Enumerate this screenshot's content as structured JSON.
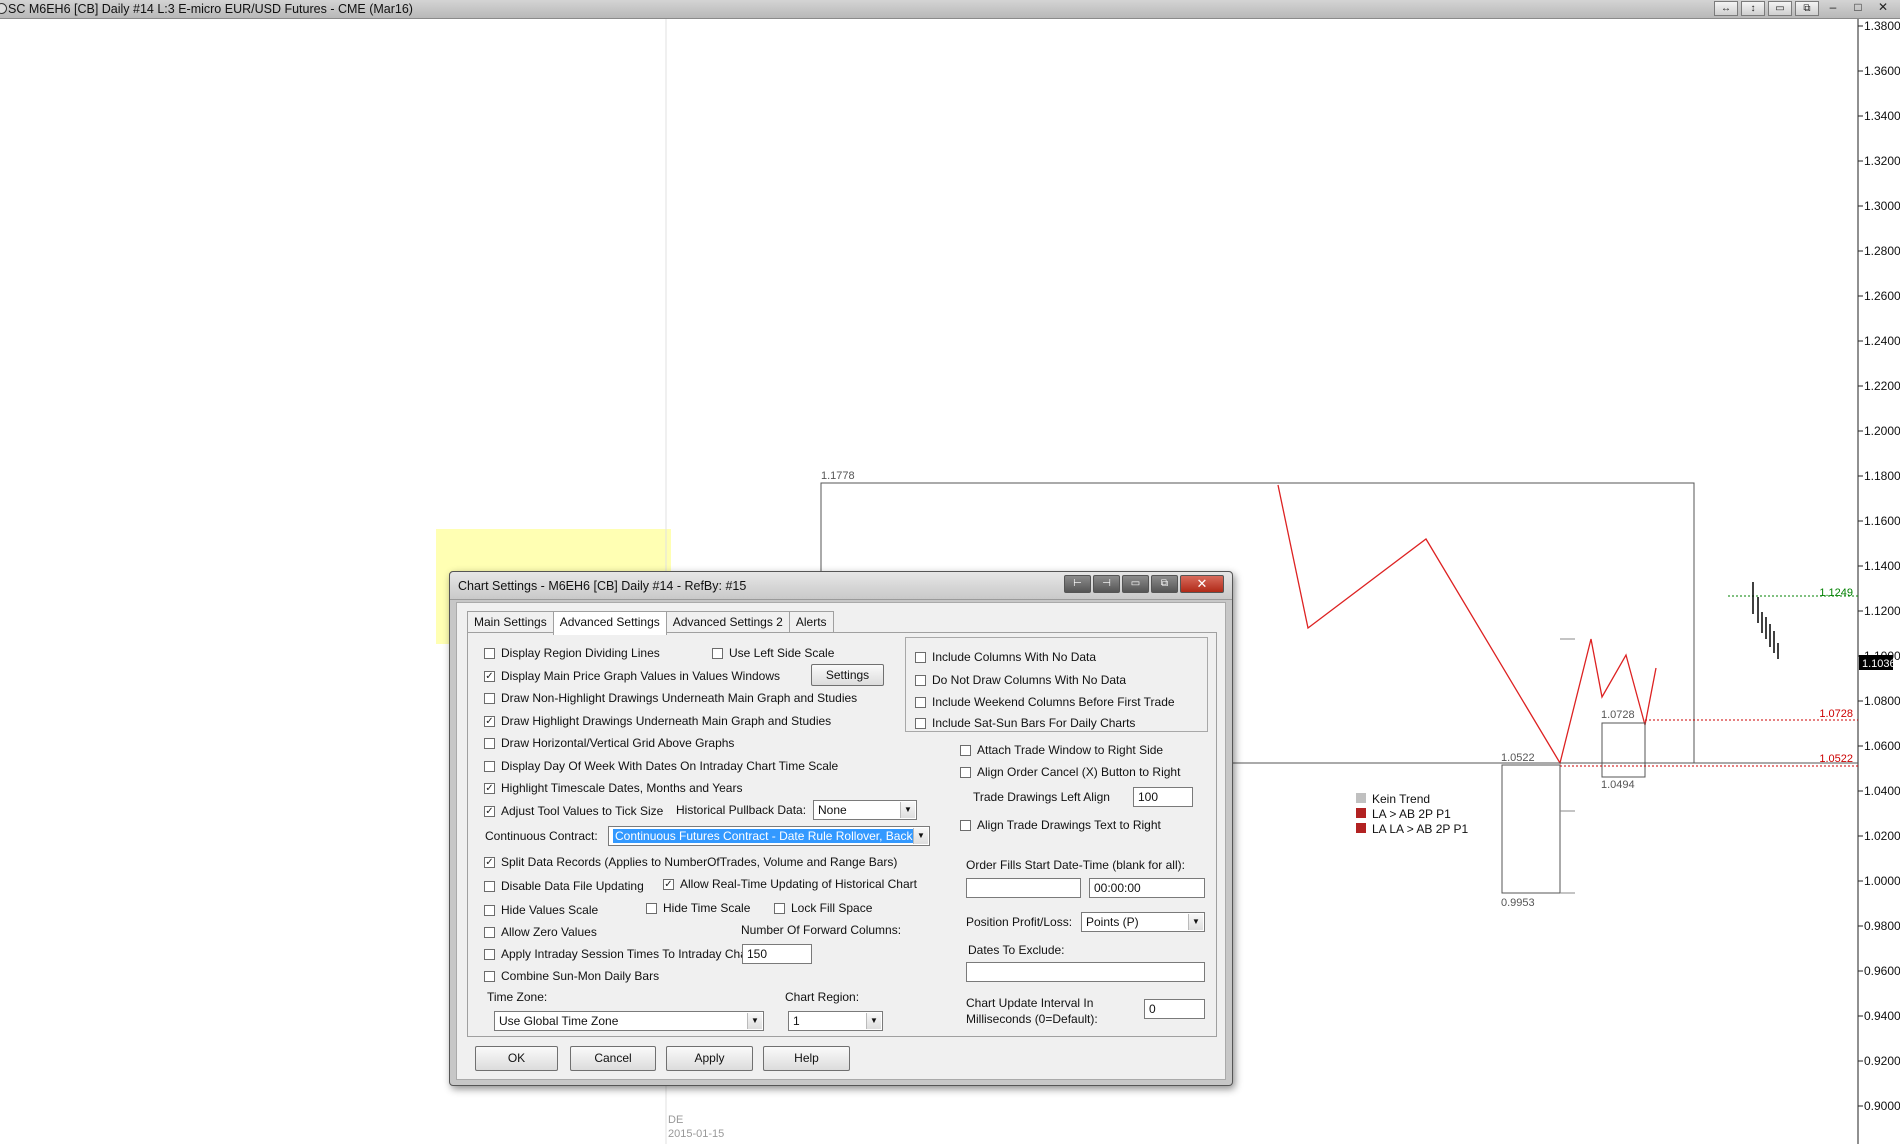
{
  "window": {
    "title": "SC M6EH6 [CB]  Daily  #14  L:3  E-micro EUR/USD Futures - CME (Mar16)",
    "buttons": [
      "↔",
      "↕",
      "▭",
      "⧉",
      "–",
      "□",
      "✕"
    ]
  },
  "chart": {
    "price_axis": [
      "1.3800",
      "1.3600",
      "1.3400",
      "1.3200",
      "1.3000",
      "1.2800",
      "1.2600",
      "1.2400",
      "1.2200",
      "1.2000",
      "1.1800",
      "1.1600",
      "1.1400",
      "1.1200",
      "1.1000",
      "1.0800",
      "1.0600",
      "1.0400",
      "1.0200",
      "1.0000",
      "0.9800",
      "0.9600",
      "0.9400",
      "0.9200",
      "0.9000"
    ],
    "current_price": "1.1036",
    "level_green": "1.1249",
    "level_red_1": "1.0728",
    "level_red_2": "1.0522",
    "label_1778": "1.1778",
    "label_1_0522": "1.0522",
    "label_0_9953": "0.9953",
    "label_1_0728": "1.0728",
    "label_1_0494": "1.0494",
    "legend": [
      {
        "text": "Kein Trend",
        "color": "#c0c0c0"
      },
      {
        "text": "LA > AB 2P P1",
        "color": "#b22222"
      },
      {
        "text": "LA LA > AB 2P P1",
        "color": "#b22222"
      }
    ],
    "x_label_de": "DE",
    "x_label_date": "2015-01-15",
    "colors": {
      "zigzag": "#dd2222",
      "green_level": "#008000",
      "red_level": "#cc0000"
    }
  },
  "dialog": {
    "title": "Chart Settings - M6EH6 [CB]  Daily  #14 - RefBy: #15",
    "title_buttons": [
      "⊢",
      "⊣",
      "▭",
      "⧉",
      "✕"
    ],
    "tabs": [
      "Main Settings",
      "Advanced Settings",
      "Advanced Settings 2",
      "Alerts"
    ],
    "active_tab": "Advanced Settings",
    "check": "✓",
    "left": {
      "display_region_dividing_lines": "Display Region Dividing Lines",
      "use_left_side_scale": "Use Left Side Scale",
      "display_main_price_graph": "Display Main Price Graph Values in Values Windows",
      "settings_button": "Settings",
      "draw_non_highlight": "Draw Non-Highlight Drawings Underneath Main Graph and Studies",
      "draw_highlight": "Draw Highlight Drawings Underneath Main Graph and Studies",
      "draw_grid_above": "Draw Horizontal/Vertical Grid Above Graphs",
      "display_day_of_week": "Display Day Of Week With Dates On Intraday Chart Time Scale",
      "highlight_timescale": "Highlight Timescale Dates, Months and Years",
      "adjust_tool_values": "Adjust Tool Values to Tick Size",
      "historical_pullback_label": "Historical Pullback Data:",
      "historical_pullback_value": "None",
      "continuous_contract_label": "Continuous Contract:",
      "continuous_contract_value": "Continuous Futures Contract - Date Rule Rollover, Back",
      "split_data_records": "Split Data Records (Applies to NumberOfTrades, Volume and Range Bars)",
      "disable_data_file_updating": "Disable Data File Updating",
      "allow_realtime_updating": "Allow Real-Time Updating of Historical Chart",
      "hide_values_scale": "Hide Values Scale",
      "hide_time_scale": "Hide Time Scale",
      "lock_fill_space": "Lock Fill Space",
      "allow_zero_values": "Allow Zero Values",
      "number_forward_columns_label": "Number Of Forward Columns:",
      "apply_intraday_session": "Apply Intraday Session Times To Intraday Chart",
      "number_forward_columns_value": "150",
      "combine_sun_mon": "Combine Sun-Mon Daily Bars",
      "time_zone_label": "Time Zone:",
      "time_zone_value": "Use Global Time Zone",
      "chart_region_label": "Chart Region:",
      "chart_region_value": "1"
    },
    "right": {
      "include_columns_no_data": "Include Columns With No Data",
      "do_not_draw_columns": "Do Not Draw Columns With No Data",
      "include_weekend_columns": "Include Weekend Columns Before First Trade",
      "include_sat_sun": "Include Sat-Sun Bars For Daily Charts",
      "attach_trade_window": "Attach Trade Window to Right Side",
      "align_order_cancel": "Align Order Cancel (X) Button to Right",
      "trade_drawings_left_align_label": "Trade Drawings Left Align",
      "trade_drawings_left_align_value": "100",
      "align_trade_drawings_text": "Align Trade Drawings Text to Right",
      "order_fills_label": "Order Fills Start Date-Time (blank for all):",
      "order_fills_date": "",
      "order_fills_time": "00:00:00",
      "position_pl_label": "Position Profit/Loss:",
      "position_pl_value": "Points (P)",
      "dates_to_exclude_label": "Dates To Exclude:",
      "dates_to_exclude_value": "",
      "chart_update_interval_label_1": "Chart Update Interval In",
      "chart_update_interval_label_2": "Milliseconds (0=Default):",
      "chart_update_interval_value": "0"
    },
    "buttons": {
      "ok": "OK",
      "cancel": "Cancel",
      "apply": "Apply",
      "help": "Help"
    }
  }
}
